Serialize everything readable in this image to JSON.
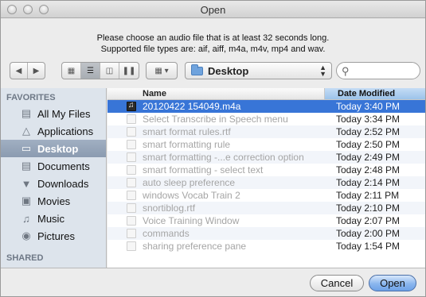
{
  "window": {
    "title": "Open"
  },
  "message": {
    "line1": "Please choose an audio file that is at least 32 seconds long.",
    "line2": "Supported file types are: aif, aiff, m4a, m4v, mp4 and wav."
  },
  "toolbar": {
    "back_icon": "chevron-left-icon",
    "forward_icon": "chevron-right-icon",
    "view_modes": [
      "icon-view",
      "list-view",
      "column-view",
      "coverflow-view"
    ],
    "active_view": "list-view",
    "arrange_icon": "arrange-icon",
    "location": "Desktop",
    "search_placeholder": ""
  },
  "sidebar": {
    "favorites_header": "FAVORITES",
    "shared_header": "SHARED",
    "items": [
      {
        "label": "All My Files",
        "icon": "all-files-icon",
        "selected": false
      },
      {
        "label": "Applications",
        "icon": "applications-icon",
        "selected": false
      },
      {
        "label": "Desktop",
        "icon": "desktop-icon",
        "selected": true
      },
      {
        "label": "Documents",
        "icon": "documents-icon",
        "selected": false
      },
      {
        "label": "Downloads",
        "icon": "downloads-icon",
        "selected": false
      },
      {
        "label": "Movies",
        "icon": "movies-icon",
        "selected": false
      },
      {
        "label": "Music",
        "icon": "music-icon",
        "selected": false
      },
      {
        "label": "Pictures",
        "icon": "pictures-icon",
        "selected": false
      }
    ]
  },
  "filelist": {
    "columns": {
      "name": "Name",
      "date": "Date Modified"
    },
    "rows": [
      {
        "name": "20120422 154049.m4a",
        "date": "Today 3:40 PM",
        "selected": true,
        "type": "audio"
      },
      {
        "name": "Select Transcribe in Speech menu",
        "date": "Today 3:34 PM",
        "selected": false,
        "type": "doc"
      },
      {
        "name": "smart format rules.rtf",
        "date": "Today 2:52 PM",
        "selected": false,
        "type": "doc"
      },
      {
        "name": "smart formatting rule",
        "date": "Today 2:50 PM",
        "selected": false,
        "type": "doc"
      },
      {
        "name": "smart formatting -...e correction option",
        "date": "Today 2:49 PM",
        "selected": false,
        "type": "doc"
      },
      {
        "name": "smart formatting - select text",
        "date": "Today 2:48 PM",
        "selected": false,
        "type": "doc"
      },
      {
        "name": "auto sleep preference",
        "date": "Today 2:14 PM",
        "selected": false,
        "type": "doc"
      },
      {
        "name": "windows Vocab Train 2",
        "date": "Today 2:11 PM",
        "selected": false,
        "type": "doc"
      },
      {
        "name": "snortiblog.rtf",
        "date": "Today 2:10 PM",
        "selected": false,
        "type": "doc"
      },
      {
        "name": "Voice Training Window",
        "date": "Today 2:07 PM",
        "selected": false,
        "type": "doc"
      },
      {
        "name": "commands",
        "date": "Today 2:00 PM",
        "selected": false,
        "type": "doc"
      },
      {
        "name": "sharing preference pane",
        "date": "Today 1:54 PM",
        "selected": false,
        "type": "doc"
      }
    ]
  },
  "buttons": {
    "cancel": "Cancel",
    "open": "Open"
  },
  "colors": {
    "selection": "#3875d7",
    "sidebar_bg": "#dde4ec",
    "sidebar_selected": "#8b9bb0",
    "default_button": "#6ea2e7"
  }
}
